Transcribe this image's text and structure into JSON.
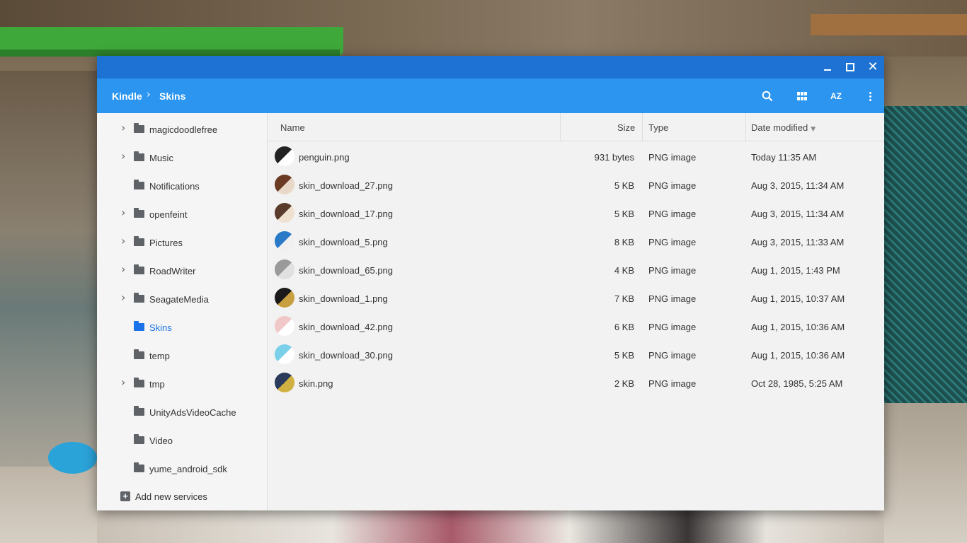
{
  "window": {
    "controls": {
      "minimize_icon": "minimize-icon",
      "maximize_icon": "maximize-icon",
      "close_glyph": "✕"
    }
  },
  "breadcrumb": {
    "items": [
      "Kindle",
      "Skins"
    ],
    "separator": "›"
  },
  "toolbar": {
    "icons": [
      "search-icon",
      "grid-view-icon",
      "sort-az-icon",
      "more-vert-icon"
    ],
    "sort_label": "AZ"
  },
  "sidebar": {
    "items": [
      {
        "label": "magicdoodlefree",
        "expandable": true,
        "active": false
      },
      {
        "label": "Music",
        "expandable": true,
        "active": false
      },
      {
        "label": "Notifications",
        "expandable": false,
        "active": false
      },
      {
        "label": "openfeint",
        "expandable": true,
        "active": false
      },
      {
        "label": "Pictures",
        "expandable": true,
        "active": false
      },
      {
        "label": "RoadWriter",
        "expandable": true,
        "active": false
      },
      {
        "label": "SeagateMedia",
        "expandable": true,
        "active": false
      },
      {
        "label": "Skins",
        "expandable": false,
        "active": true
      },
      {
        "label": "temp",
        "expandable": false,
        "active": false
      },
      {
        "label": "tmp",
        "expandable": true,
        "active": false
      },
      {
        "label": "UnityAdsVideoCache",
        "expandable": false,
        "active": false
      },
      {
        "label": "Video",
        "expandable": false,
        "active": false
      },
      {
        "label": "yume_android_sdk",
        "expandable": false,
        "active": false
      }
    ],
    "add_services": "Add new services"
  },
  "columns": {
    "name": "Name",
    "size": "Size",
    "type": "Type",
    "date": "Date modified",
    "sort_arrow": "▼"
  },
  "files": [
    {
      "name": "penguin.png",
      "size": "931 bytes",
      "type": "PNG image",
      "date": "Today 11:35 AM",
      "thumb_colors": [
        "#222222",
        "#ffffff"
      ]
    },
    {
      "name": "skin_download_27.png",
      "size": "5 KB",
      "type": "PNG image",
      "date": "Aug 3, 2015, 11:34 AM",
      "thumb_colors": [
        "#6a3a22",
        "#e8d8c8"
      ]
    },
    {
      "name": "skin_download_17.png",
      "size": "5 KB",
      "type": "PNG image",
      "date": "Aug 3, 2015, 11:34 AM",
      "thumb_colors": [
        "#5a3a2a",
        "#f0e0d0"
      ]
    },
    {
      "name": "skin_download_5.png",
      "size": "8 KB",
      "type": "PNG image",
      "date": "Aug 3, 2015, 11:33 AM",
      "thumb_colors": [
        "#2a7ac8",
        "#f0f0f0"
      ]
    },
    {
      "name": "skin_download_65.png",
      "size": "4 KB",
      "type": "PNG image",
      "date": "Aug 1, 2015, 1:43 PM",
      "thumb_colors": [
        "#9a9a9a",
        "#e0e0e0"
      ]
    },
    {
      "name": "skin_download_1.png",
      "size": "7 KB",
      "type": "PNG image",
      "date": "Aug 1, 2015, 10:37 AM",
      "thumb_colors": [
        "#1a1a1a",
        "#c8a040"
      ]
    },
    {
      "name": "skin_download_42.png",
      "size": "6 KB",
      "type": "PNG image",
      "date": "Aug 1, 2015, 10:36 AM",
      "thumb_colors": [
        "#f0c8c8",
        "#ffffff"
      ]
    },
    {
      "name": "skin_download_30.png",
      "size": "5 KB",
      "type": "PNG image",
      "date": "Aug 1, 2015, 10:36 AM",
      "thumb_colors": [
        "#7ad0e8",
        "#ffffff"
      ]
    },
    {
      "name": "skin.png",
      "size": "2 KB",
      "type": "PNG image",
      "date": "Oct 28, 1985, 5:25 AM",
      "thumb_colors": [
        "#2a3a5a",
        "#d0b040"
      ]
    }
  ],
  "colors": {
    "titlebar": "#1d72d4",
    "toolbar": "#2b95f0",
    "active": "#1a73e8"
  }
}
